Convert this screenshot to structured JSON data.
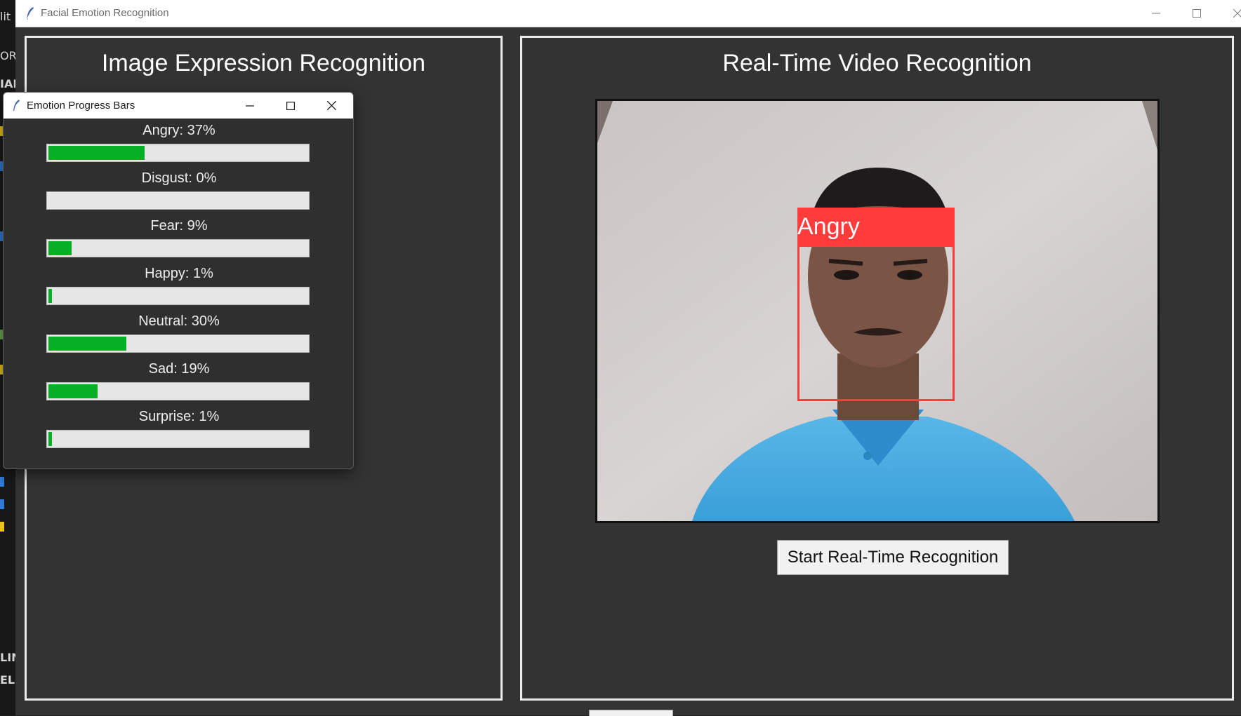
{
  "background_editor": {
    "fragments": [
      "lit",
      "OR",
      "IAR",
      "LIN",
      "ELII"
    ]
  },
  "main_window": {
    "title": "Facial Emotion Recognition",
    "controls": {
      "minimize": "minimize-icon",
      "maximize": "maximize-icon",
      "close": "close-icon"
    },
    "left_panel": {
      "title": "Image Expression Recognition"
    },
    "right_panel": {
      "title": "Real-Time Video Recognition",
      "detection_label": "Angry",
      "detection_color": "#ff3b3b",
      "start_button": "Start Real-Time Recognition"
    }
  },
  "popup": {
    "title": "Emotion Progress Bars",
    "bar_color": "#06b025",
    "emotions": [
      {
        "label": "Angry: 37%",
        "percent": 37
      },
      {
        "label": "Disgust: 0%",
        "percent": 0
      },
      {
        "label": "Fear: 9%",
        "percent": 9
      },
      {
        "label": "Happy: 1%",
        "percent": 1
      },
      {
        "label": "Neutral: 30%",
        "percent": 30
      },
      {
        "label": "Sad: 19%",
        "percent": 19
      },
      {
        "label": "Surprise: 1%",
        "percent": 1
      }
    ]
  }
}
